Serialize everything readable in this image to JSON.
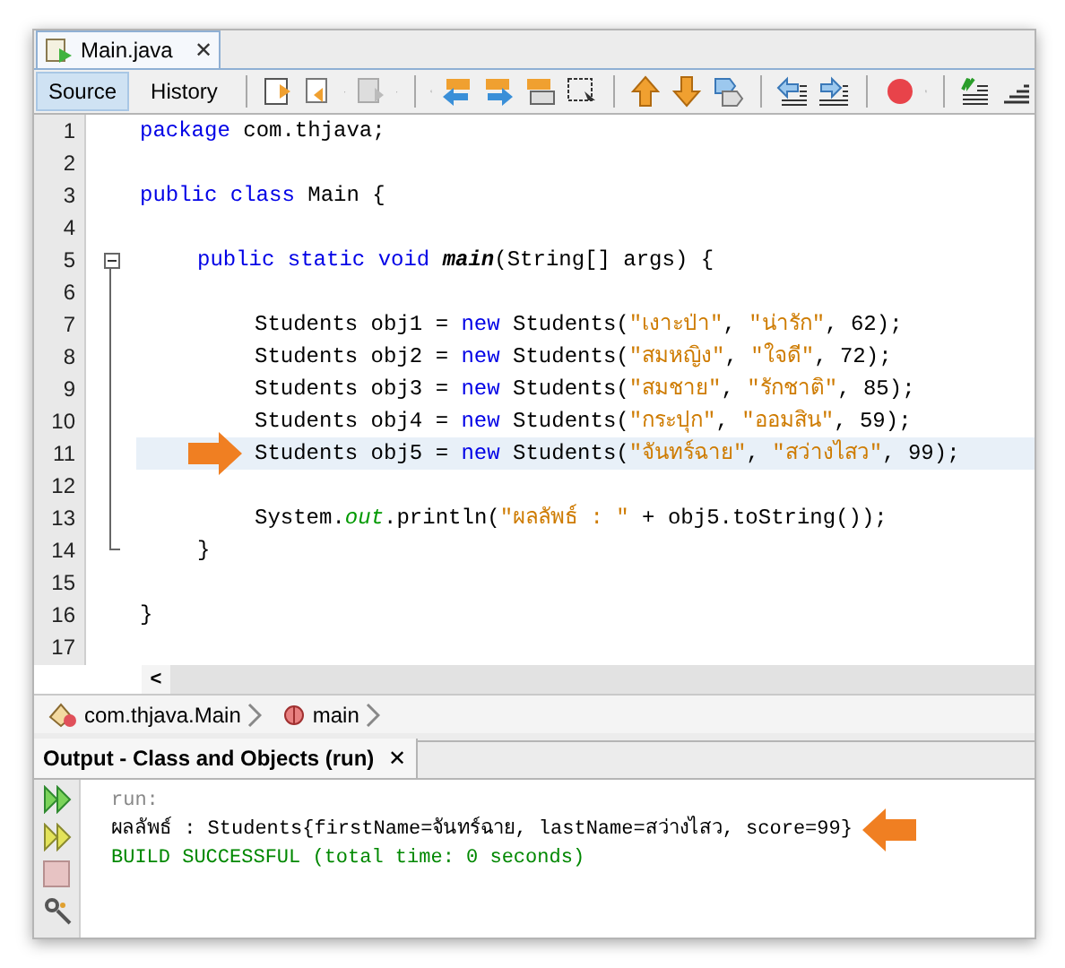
{
  "editor_tab": {
    "title": "Main.java",
    "close": "✕"
  },
  "view_tabs": [
    {
      "label": "Source",
      "selected": true
    },
    {
      "label": "History",
      "selected": false
    }
  ],
  "code_lines": [
    {
      "number": "1",
      "highlighted": false,
      "foldable": false,
      "tokens": [
        {
          "kind": "keyword",
          "text": "package"
        },
        {
          "kind": "text",
          "text": " com.thjava;"
        }
      ]
    },
    {
      "number": "2",
      "highlighted": false,
      "foldable": false
    },
    {
      "number": "3",
      "highlighted": false,
      "foldable": false,
      "tokens": [
        {
          "kind": "keyword",
          "text": "public class"
        },
        {
          "kind": "text",
          "text": " Main {"
        }
      ]
    },
    {
      "number": "4",
      "highlighted": false,
      "foldable": false
    },
    {
      "number": "5",
      "highlighted": false,
      "foldable": true,
      "kind": "member",
      "tokens": [
        {
          "kind": "keyword",
          "text": "public static void "
        },
        {
          "kind": "method",
          "text": "main"
        },
        {
          "kind": "text",
          "text": "(String[] args) {"
        }
      ]
    },
    {
      "number": "6",
      "highlighted": false,
      "foldable": false
    },
    {
      "number": "7",
      "highlighted": false,
      "foldable": false,
      "kind": "statement",
      "tokens": [
        {
          "kind": "text",
          "text": "Students obj1 = "
        },
        {
          "kind": "keyword",
          "text": "new"
        },
        {
          "kind": "text",
          "text": " Students("
        },
        {
          "kind": "string",
          "text": "\"เงาะป่า\""
        },
        {
          "kind": "text",
          "text": ", "
        },
        {
          "kind": "string",
          "text": "\"น่ารัก\""
        },
        {
          "kind": "text",
          "text": ", 62);"
        }
      ]
    },
    {
      "number": "8",
      "highlighted": false,
      "foldable": false,
      "kind": "statement",
      "tokens": [
        {
          "kind": "text",
          "text": "Students obj2 = "
        },
        {
          "kind": "keyword",
          "text": "new"
        },
        {
          "kind": "text",
          "text": " Students("
        },
        {
          "kind": "string",
          "text": "\"สมหญิง\""
        },
        {
          "kind": "text",
          "text": ", "
        },
        {
          "kind": "string",
          "text": "\"ใจดี\""
        },
        {
          "kind": "text",
          "text": ", 72);"
        }
      ]
    },
    {
      "number": "9",
      "highlighted": false,
      "foldable": false,
      "kind": "statement",
      "tokens": [
        {
          "kind": "text",
          "text": "Students obj3 = "
        },
        {
          "kind": "keyword",
          "text": "new"
        },
        {
          "kind": "text",
          "text": " Students("
        },
        {
          "kind": "string",
          "text": "\"สมชาย\""
        },
        {
          "kind": "text",
          "text": ", "
        },
        {
          "kind": "string",
          "text": "\"รักชาติ\""
        },
        {
          "kind": "text",
          "text": ", 85);"
        }
      ]
    },
    {
      "number": "10",
      "highlighted": false,
      "foldable": false,
      "kind": "statement",
      "tokens": [
        {
          "kind": "text",
          "text": "Students obj4 = "
        },
        {
          "kind": "keyword",
          "text": "new"
        },
        {
          "kind": "text",
          "text": " Students("
        },
        {
          "kind": "string",
          "text": "\"กระปุก\""
        },
        {
          "kind": "text",
          "text": ", "
        },
        {
          "kind": "string",
          "text": "\"ออมสิน\""
        },
        {
          "kind": "text",
          "text": ", 59);"
        }
      ]
    },
    {
      "number": "11",
      "highlighted": true,
      "foldable": false,
      "kind": "statement",
      "tokens": [
        {
          "kind": "text",
          "text": "Students obj5 = "
        },
        {
          "kind": "keyword",
          "text": "new"
        },
        {
          "kind": "text",
          "text": " Students("
        },
        {
          "kind": "string",
          "text": "\"จันทร์ฉาย\""
        },
        {
          "kind": "text",
          "text": ", "
        },
        {
          "kind": "string",
          "text": "\"สว่างไสว\""
        },
        {
          "kind": "text",
          "text": ", 99);"
        }
      ]
    },
    {
      "number": "12",
      "highlighted": false,
      "foldable": false
    },
    {
      "number": "13",
      "highlighted": false,
      "foldable": false,
      "kind": "statement",
      "tokens": [
        {
          "kind": "text",
          "text": "System."
        },
        {
          "kind": "field",
          "text": "out"
        },
        {
          "kind": "text",
          "text": ".println("
        },
        {
          "kind": "string",
          "text": "\"ผลลัพธ์ : \""
        },
        {
          "kind": "text",
          "text": " + obj5.toString());"
        }
      ]
    },
    {
      "number": "14",
      "highlighted": false,
      "foldable": false,
      "kind": "member",
      "tokens": [
        {
          "kind": "text",
          "text": "}"
        }
      ]
    },
    {
      "number": "15",
      "highlighted": false,
      "foldable": false
    },
    {
      "number": "16",
      "highlighted": false,
      "foldable": false,
      "tokens": [
        {
          "kind": "text",
          "text": "}"
        }
      ]
    },
    {
      "number": "17",
      "highlighted": false,
      "foldable": false
    }
  ],
  "scroll_left": "<",
  "breadcrumbs": [
    {
      "label": "com.thjava.Main",
      "kind": "class"
    },
    {
      "label": "main",
      "kind": "method"
    }
  ],
  "output": {
    "title": "Output - Class and Objects (run)",
    "close": "✕",
    "lines": [
      {
        "kind": "info",
        "text": "run:"
      },
      {
        "kind": "normal",
        "text": "ผลลัพธ์ : Students{firstName=จันทร์ฉาย, lastName=สว่างไสว, score=99}"
      },
      {
        "kind": "success",
        "text": "BUILD SUCCESSFUL (total time: 0 seconds)"
      }
    ]
  }
}
